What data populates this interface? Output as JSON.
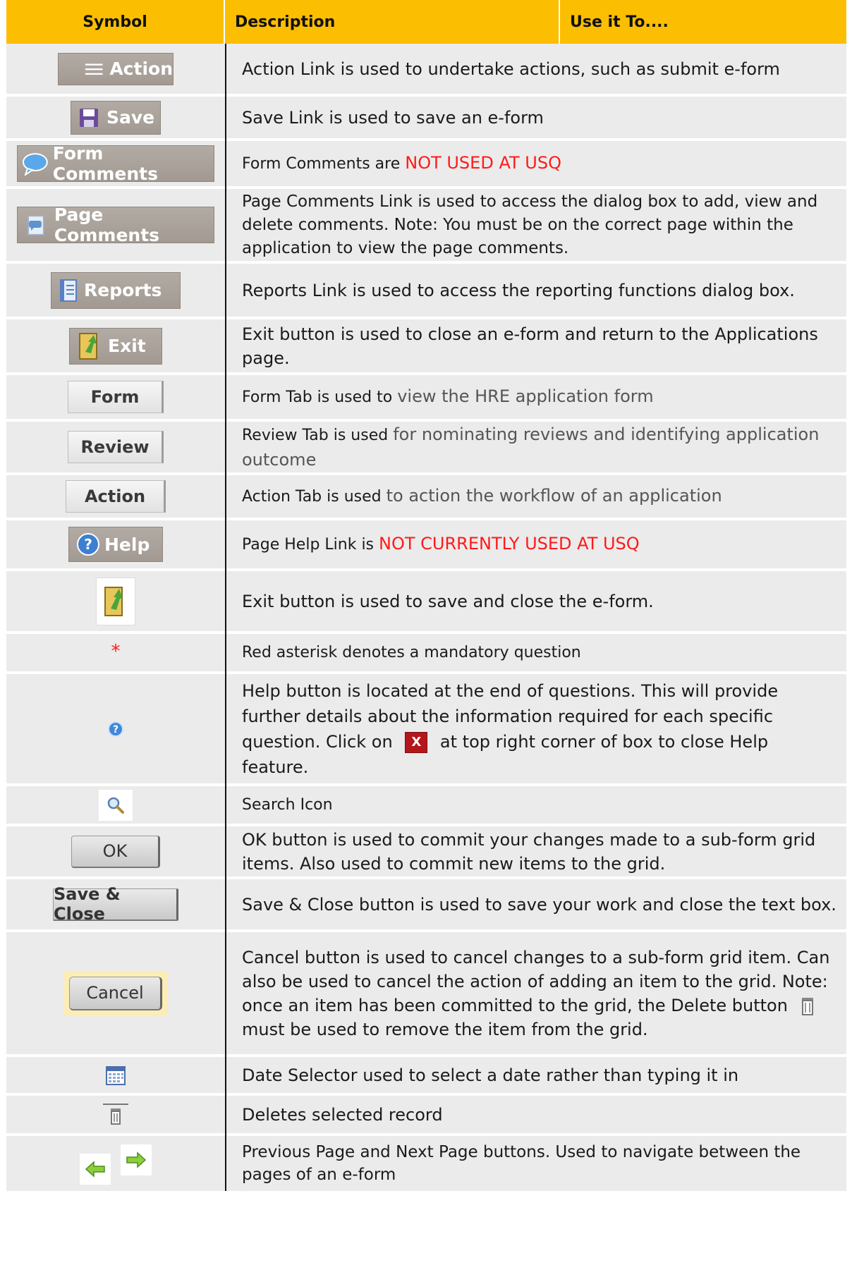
{
  "header": {
    "symbol": "Symbol",
    "description": "Description",
    "use": "Use it To...."
  },
  "rows": [
    {
      "symbol_label": "Action",
      "symbol_icon": "menu-icon",
      "desc": "Action Link is used to undertake actions, such as submit e-form"
    },
    {
      "symbol_label": "Save",
      "symbol_icon": "floppy-disk-icon",
      "desc": "Save Link is used to save an e-form"
    },
    {
      "symbol_label": "Form Comments",
      "symbol_icon": "speech-bubble-icon",
      "desc_a": "Form Comments are ",
      "desc_b": "NOT USED AT USQ"
    },
    {
      "symbol_label": "Page Comments",
      "symbol_icon": "page-comment-icon",
      "desc": "Page Comments Link is used to access the dialog box to add, view and delete comments. Note: You must be on the correct page within the application to view the page comments."
    },
    {
      "symbol_label": "Reports",
      "symbol_icon": "report-icon",
      "desc": "Reports Link is used to access the reporting functions dialog box."
    },
    {
      "symbol_label": "Exit",
      "symbol_icon": "exit-door-icon",
      "desc": "Exit button is used to close an e-form and return to the Applications page."
    },
    {
      "symbol_label": "Form",
      "desc_a": "Form Tab is used to ",
      "desc_b": "view the HRE application form"
    },
    {
      "symbol_label": "Review",
      "desc_a": "Review Tab is used ",
      "desc_b": "for nominating reviews and identifying application outcome"
    },
    {
      "symbol_label": "Action",
      "desc_a": "Action Tab is used ",
      "desc_b": "to action the workflow of an application"
    },
    {
      "symbol_label": "Help",
      "symbol_icon": "question-circle-icon",
      "desc_a": "Page Help Link is ",
      "desc_b": "NOT CURRENTLY USED AT USQ"
    },
    {
      "symbol_icon": "exit-door-icon",
      "desc": "Exit button is used to save and close the e-form."
    },
    {
      "symbol_label": "*",
      "desc": "Red asterisk denotes a mandatory question"
    },
    {
      "symbol_icon": "help-icon",
      "desc_a": "Help button is located at the end of questions.  This will provide further details about the information required for each specific question.  Click on ",
      "close_icon_label": "X",
      "desc_b": " at top right corner of box to close Help feature."
    },
    {
      "symbol_icon": "search-icon",
      "desc": "Search Icon"
    },
    {
      "symbol_label": "OK",
      "desc": "OK button is used to commit your changes made to a sub-form grid items.  Also used to commit new items to the grid."
    },
    {
      "symbol_label": "Save & Close",
      "desc": "Save & Close button is used to save your work and close the text box."
    },
    {
      "symbol_label": "Cancel",
      "desc_a": "Cancel button is used to cancel changes to a sub-form grid item.  Can also be used to cancel the action of adding an item to the grid.  Note: once an item has been committed to the grid, the Delete button ",
      "desc_b": " must be used to remove the item from the grid."
    },
    {
      "symbol_icon": "calendar-icon",
      "desc": "Date Selector used to select a date rather than typing it in"
    },
    {
      "symbol_icon": "trash-icon",
      "desc": "Deletes selected record"
    },
    {
      "symbol_icon": "arrow-left-right-icons",
      "desc": "Previous Page and Next Page buttons.  Used to navigate between the pages of an e-form"
    }
  ],
  "colors": {
    "header_bg": "#fcbe00",
    "row_shade": "#ebebeb",
    "highlight_red": "#ff1a1a"
  }
}
